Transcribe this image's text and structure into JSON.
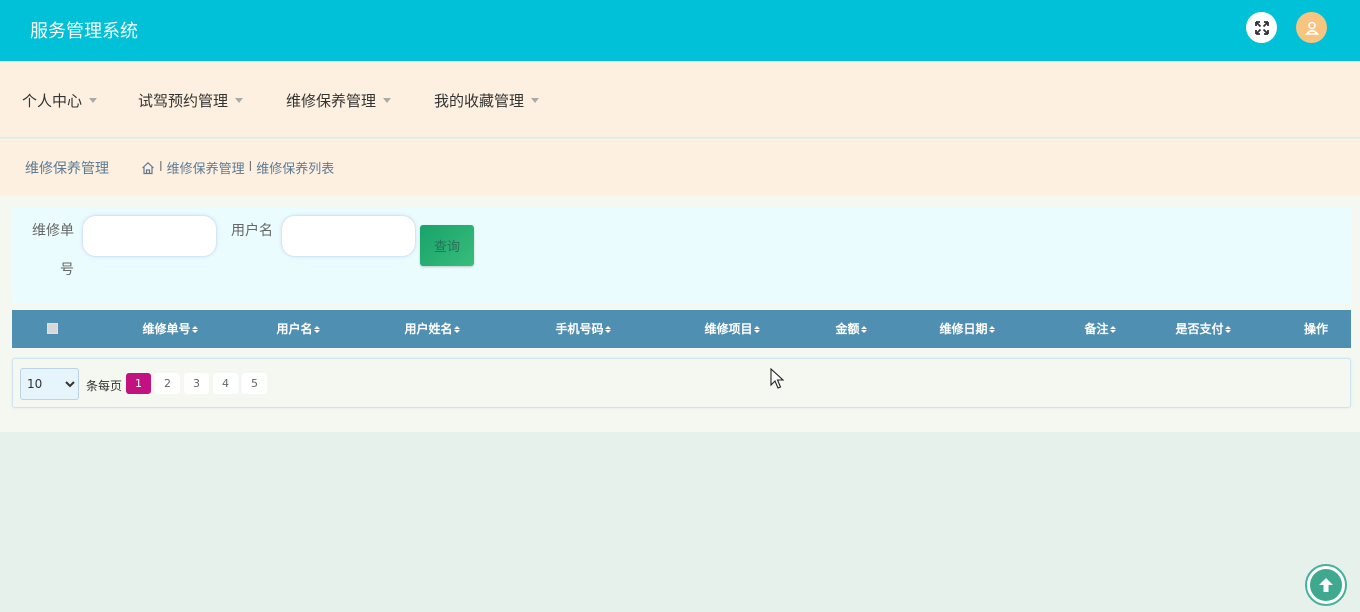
{
  "app": {
    "title": "服务管理系统"
  },
  "header": {
    "fullscreen_icon": "expand-arrows-icon",
    "user_icon": "user-icon"
  },
  "nav": {
    "items": [
      {
        "label": "个人中心"
      },
      {
        "label": "试驾预约管理"
      },
      {
        "label": "维修保养管理"
      },
      {
        "label": "我的收藏管理"
      }
    ]
  },
  "breadcrumb": {
    "title": "维修保养管理",
    "home_icon": "home-icon",
    "separator": "l",
    "path": [
      "维修保养管理",
      "维修保养列表"
    ]
  },
  "search": {
    "fields": [
      {
        "label": "维修单号",
        "value": "",
        "placeholder": ""
      },
      {
        "label": "用户名",
        "value": "",
        "placeholder": ""
      }
    ],
    "query_button": "查询"
  },
  "table": {
    "columns": [
      "维修单号",
      "用户名",
      "用户姓名",
      "手机号码",
      "维修项目",
      "金额",
      "维修日期",
      "备注",
      "是否支付",
      "操作"
    ],
    "rows": []
  },
  "pagination": {
    "page_size": "10",
    "page_size_options": [
      "10"
    ],
    "per_page_label": "条每页",
    "pages": [
      "1",
      "2",
      "3",
      "4",
      "5"
    ],
    "current_page": "1"
  },
  "colors": {
    "topbar": "#00c1d8",
    "nav_background": "#fef0e0",
    "table_header": "#4f8fb1",
    "active_page": "#c2127f",
    "query_button": "#18a36a",
    "back_to_top": "#3fa98f"
  }
}
